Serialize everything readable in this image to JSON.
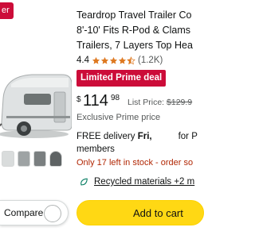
{
  "badge": {
    "label": "er"
  },
  "product": {
    "title_lines": [
      "Teardrop Travel Trailer Co",
      "8'-10' Fits R-Pod & Clams",
      "Trailers, 7 Layers Top Hea"
    ],
    "rating": "4.4",
    "rating_stars": 4.5,
    "rating_count": "(1.2K)",
    "deal_label": "Limited Prime deal",
    "price": {
      "symbol": "$",
      "whole": "114",
      "fraction": "98"
    },
    "list_price_label": "List Price:",
    "list_price": "$129.9",
    "exclusive": "Exclusive Prime price",
    "delivery_prefix": "FREE delivery",
    "delivery_day": "Fri,",
    "delivery_suffix": "for P",
    "delivery_members": "members",
    "stock": "Only 17 left in stock - order so",
    "recycled": "Recycled materials +2 m"
  },
  "actions": {
    "compare": "Compare",
    "add_to_cart": "Add to cart"
  },
  "colors": {
    "deal_red": "#cc0c39",
    "stock_red": "#b12704",
    "star_orange": "#de7921",
    "cart_yellow": "#ffd814",
    "eco_green": "#067d62"
  },
  "icons": {
    "stars": "star-rating-icon",
    "recycled": "leaf-icon"
  }
}
